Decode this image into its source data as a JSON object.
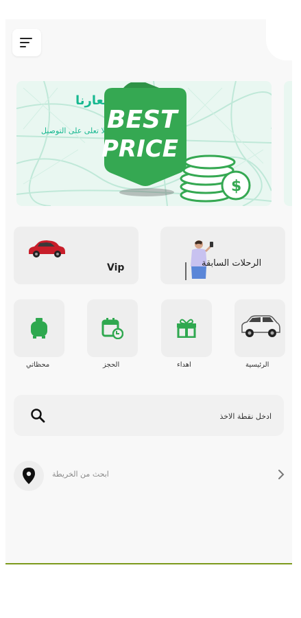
{
  "banner": {
    "title": "أسعارنا",
    "subtitle": "أسعار لا تعلى على التوصيل",
    "badge_line1": "BEST",
    "badge_line2": "PRICE"
  },
  "categories": [
    {
      "label": "Vip",
      "image": "red-car-icon"
    },
    {
      "label": "الرحلات السابقة",
      "image": "person-with-phone-illustration"
    }
  ],
  "services": [
    {
      "label": "محظاتي",
      "icon": "gas-cylinder-icon"
    },
    {
      "label": "الحجز",
      "icon": "calendar-refresh-icon"
    },
    {
      "label": "اهداء",
      "icon": "gift-icon"
    },
    {
      "label": "الرئيسية",
      "icon": "suv-car-icon"
    }
  ],
  "search": {
    "placeholder": "ادخل نقطة الاخذ"
  },
  "map_search": {
    "label": "ابحث من الخريطة"
  },
  "colors": {
    "accent": "#2fa84f",
    "banner_text": "#17b890",
    "card_bg": "#eeeeee"
  }
}
